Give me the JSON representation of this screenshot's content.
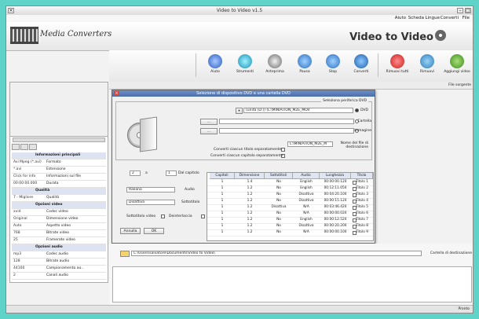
{
  "window": {
    "title": "Video to Video v1.5"
  },
  "menu": [
    "File",
    "Converti",
    "Lingue",
    "Scheda",
    "Aiuto"
  ],
  "banner": {
    "logo": "Media Converters",
    "brand": "Video to Video"
  },
  "toolbar": [
    "Aggiungi video",
    "Rimuovi",
    "Rimuovi tutti",
    "Converti",
    "Stop",
    "Pausa",
    "Anteprima",
    "Strumenti",
    "Aiuto"
  ],
  "file_strip": "File sorgente",
  "properties": [
    {
      "sec": true,
      "k": "Informazioni principali"
    },
    {
      "k": "Formato",
      "v": "Avi Mpeg (*.avi)"
    },
    {
      "k": "Estensione",
      "v": "*.avi"
    },
    {
      "k": "Informazioni sul file",
      "v": "Click for info"
    },
    {
      "k": "Durata",
      "v": "00:00:00.000"
    },
    {
      "sec": true,
      "k": "Qualità"
    },
    {
      "k": "Qualità",
      "v": "7 - Migliore"
    },
    {
      "sec": true,
      "k": "Opzioni video"
    },
    {
      "k": "Codec video",
      "v": "xvid"
    },
    {
      "k": "Dimensione video",
      "v": "Original"
    },
    {
      "k": "Aspetto video",
      "v": "Auto"
    },
    {
      "k": "Bitrate video",
      "v": "768"
    },
    {
      "k": "Framerate video",
      "v": "25"
    },
    {
      "sec": true,
      "k": "Opzioni audio"
    },
    {
      "k": "Codec audio",
      "v": "mp3"
    },
    {
      "k": "Bitrate audio",
      "v": "128"
    },
    {
      "k": "Campionamento au..",
      "v": "44100"
    },
    {
      "k": "Canali audio",
      "v": "2"
    }
  ],
  "dialog": {
    "title": "Selezione di dispositivo DVD e una cartella DVD",
    "group_label": "Seleziona periferica DVD",
    "dvd_label": "DVD",
    "dvd_value": "(unità (D:)) (L:\\MINIATION_M2E_MOV",
    "folder_label": "Cartella",
    "image_label": "Immagine",
    "volume_label": "Nome del file di destinazione",
    "volume_value": "L:\\MINIATION_M2E_M",
    "check1": "Converti ciascun titolo separatamente",
    "check2": "Converti ciascun capitolo separatamente",
    "chapter_from": "Dal capitolo",
    "chapter_to": "a",
    "chapter_from_val": "1",
    "chapter_to_val": "2",
    "audio_label": "Audio",
    "audio_value": "Italiano",
    "subs_label": "Sottotitolo",
    "subs_value": "Disattiva",
    "cb_subs": "Sottotitolo video",
    "cb_dir": "Deinterlaccia",
    "ok": "OK",
    "cancel": "Annulla",
    "columns": [
      "Titolo",
      "Lunghezza",
      "Audio",
      "Sottotitoli",
      "Dimensione",
      "Capitoli"
    ],
    "rows": [
      [
        "Titolo 1",
        "00:00:00.120",
        "English",
        "No",
        "1.4",
        "1"
      ],
      [
        "Titolo 2",
        "00:12:11.050",
        "English",
        "No",
        "1.2",
        "1"
      ],
      [
        "Titolo 3",
        "00:04:20.100",
        "Disattiva",
        "No",
        "1.2",
        "1"
      ],
      [
        "Titolo 4",
        "00:00:15.120",
        "Disattiva",
        "No",
        "1.2",
        "1"
      ],
      [
        "Titolo 5",
        "00:03:46.420",
        "N/A",
        "Disattiva",
        "1.2",
        "1"
      ],
      [
        "Titolo 6",
        "00:00:00.020",
        "N/A",
        "No",
        "1.2",
        "1"
      ],
      [
        "Titolo 7",
        "00:00:12.520",
        "English",
        "No",
        "1.2",
        "1"
      ],
      [
        "Titolo 8",
        "00:00:20.200",
        "Disattiva",
        "No",
        "1.2",
        "1"
      ],
      [
        "Titolo 9",
        "00:00:00.100",
        "N/A",
        "No",
        "1.2",
        "1"
      ]
    ]
  },
  "output": {
    "label": "Cartella di destinazione",
    "path": "C:\\Users\\salvatore\\Documents\\Video to Video\\"
  },
  "status": "Pronto"
}
